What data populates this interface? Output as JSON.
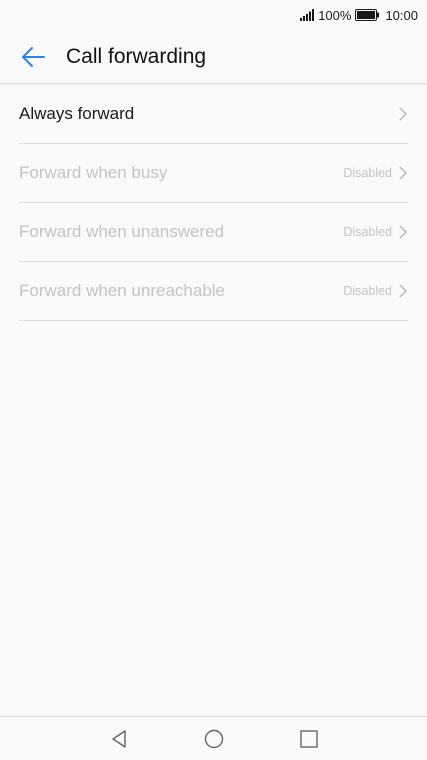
{
  "status_bar": {
    "battery_percent": "100%",
    "time": "10:00"
  },
  "header": {
    "title": "Call forwarding",
    "back_icon": "arrow-left-icon",
    "accent_color": "#2a86e6"
  },
  "list": {
    "items": [
      {
        "label": "Always forward",
        "status": "",
        "enabled": true
      },
      {
        "label": "Forward when busy",
        "status": "Disabled",
        "enabled": false
      },
      {
        "label": "Forward when unanswered",
        "status": "Disabled",
        "enabled": false
      },
      {
        "label": "Forward when unreachable",
        "status": "Disabled",
        "enabled": false
      }
    ]
  },
  "nav_bar": {
    "back_icon": "triangle-back-icon",
    "home_icon": "circle-home-icon",
    "recents_icon": "square-recents-icon"
  }
}
